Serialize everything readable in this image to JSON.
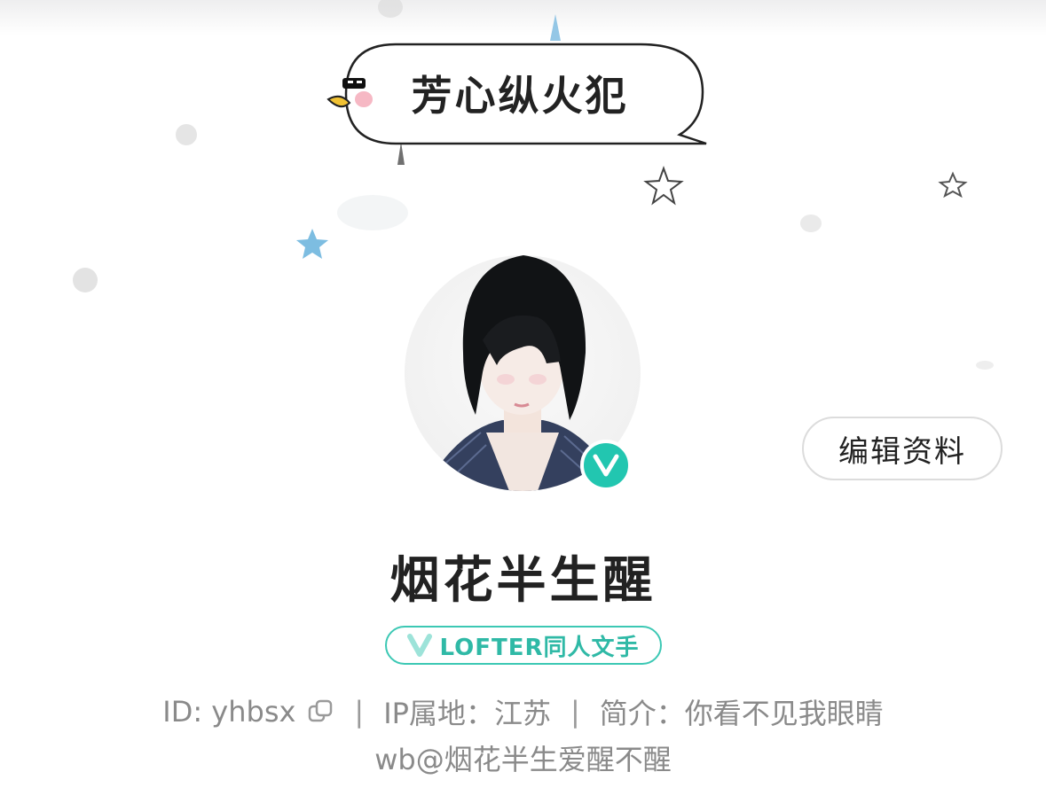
{
  "speech_bubble": {
    "text": "芳心纵火犯"
  },
  "profile": {
    "username": "烟花半生醒",
    "verified_badge": "V",
    "edit_button": "编辑资料",
    "tag": {
      "icon": "V",
      "label": "LOFTER同人文手"
    },
    "id_label": "ID: yhbsx",
    "separator": "|",
    "ip_label": "IP属地：江苏",
    "bio_label": "简介：你看不见我眼睛",
    "bio_line2": "wb@烟花半生爱醒不醒"
  },
  "colors": {
    "accent": "#22c6b0",
    "text_primary": "#222222",
    "text_secondary": "#8a8a8a",
    "star_blue": "#6fb6de"
  },
  "icons": [
    "duck-sunglasses-icon",
    "verified-v-icon",
    "copy-icon",
    "star-icon"
  ]
}
